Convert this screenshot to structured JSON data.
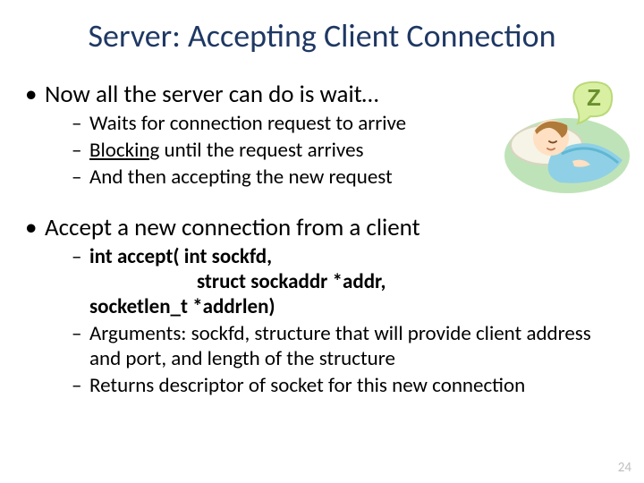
{
  "title": "Server: Accepting Client Connection",
  "b1": {
    "text": "Now all the server can do is wait…",
    "s1": "Waits for connection request to arrive",
    "s2a": "Blocking",
    "s2b": " until the request arrives",
    "s3": "And then accepting the new request"
  },
  "b2": {
    "text": "Accept a new connection from a client",
    "sig1": "int accept( int sockfd,",
    "sig2": "struct sockaddr *addr,",
    "sig3": "socketlen_t *addrlen)",
    "s2": "Arguments: sockfd, structure that will provide client address and port, and length of the structure",
    "s3": "Returns descriptor of socket for this new connection"
  },
  "page": "24",
  "icon": {
    "sleep": "sleeping-child-z-icon"
  }
}
